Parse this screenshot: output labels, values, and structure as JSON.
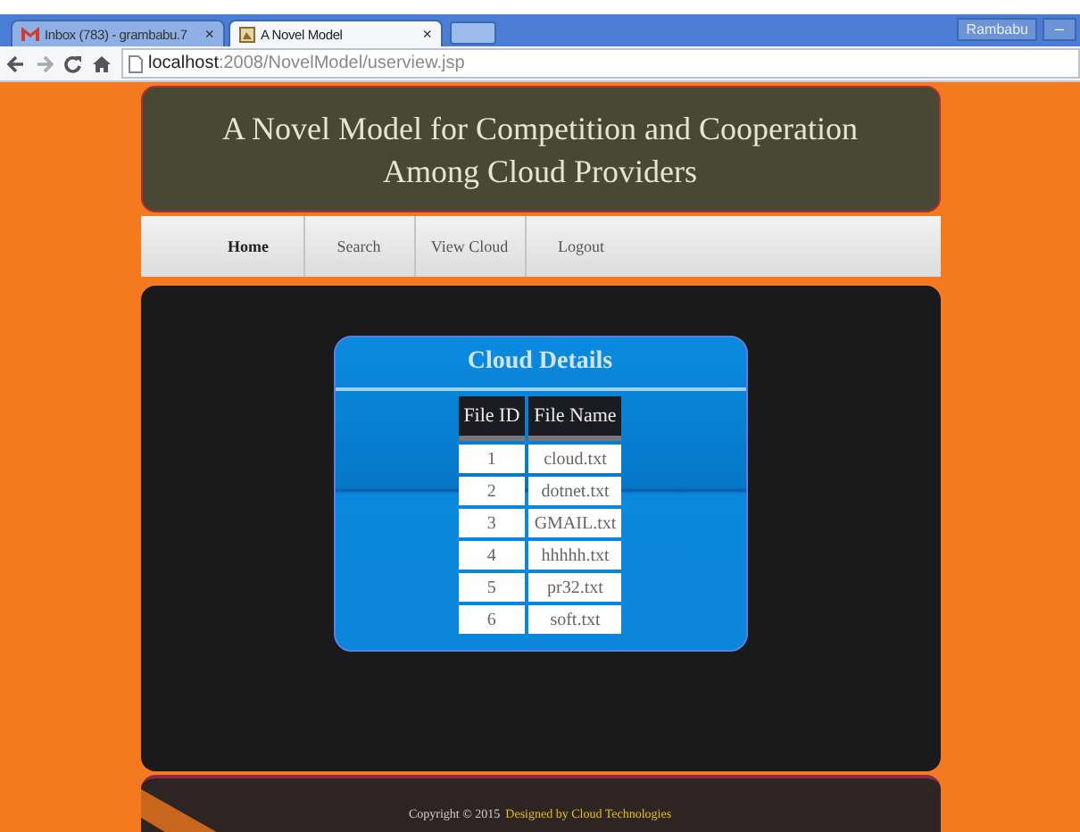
{
  "browser": {
    "tabs": [
      {
        "title": "Inbox (783) - grambabu.7",
        "close": "×",
        "selected": false
      },
      {
        "title": "A Novel Model",
        "close": "×",
        "selected": true
      }
    ],
    "user": "Rambabu",
    "minimize": "–",
    "url_host": "localhost",
    "url_path": ":2008/NovelModel/userview.jsp"
  },
  "header": {
    "title": "A Novel Model for Competition and Cooperation Among Cloud Providers"
  },
  "nav": [
    {
      "label": "Home",
      "selected": true
    },
    {
      "label": "Search",
      "selected": false
    },
    {
      "label": "View Cloud",
      "selected": false
    },
    {
      "label": "Logout",
      "selected": false
    }
  ],
  "card": {
    "title": "Cloud Details",
    "columns": [
      "File ID",
      "File Name"
    ],
    "rows": [
      [
        "1",
        "cloud.txt"
      ],
      [
        "2",
        "dotnet.txt"
      ],
      [
        "3",
        "GMAIL.txt"
      ],
      [
        "4",
        "hhhhh.txt"
      ],
      [
        "5",
        "pr32.txt"
      ],
      [
        "6",
        "soft.txt"
      ]
    ]
  },
  "footer": {
    "copyright": "Copyright © 2015",
    "credit": "Designed by Cloud Technologies"
  }
}
